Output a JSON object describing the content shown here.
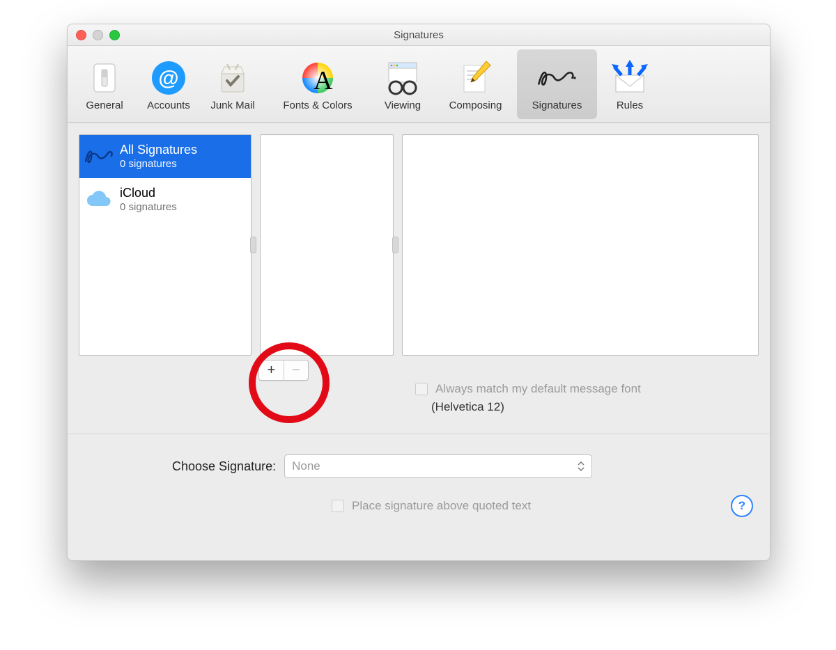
{
  "window": {
    "title": "Signatures"
  },
  "toolbar": [
    {
      "id": "general",
      "label": "General",
      "icon": "switch-icon",
      "selected": false
    },
    {
      "id": "accounts",
      "label": "Accounts",
      "icon": "at-icon",
      "selected": false
    },
    {
      "id": "junk",
      "label": "Junk Mail",
      "icon": "trash-icon",
      "selected": false
    },
    {
      "id": "fonts",
      "label": "Fonts & Colors",
      "icon": "colorwheel-icon",
      "selected": false
    },
    {
      "id": "viewing",
      "label": "Viewing",
      "icon": "glasses-icon",
      "selected": false
    },
    {
      "id": "composing",
      "label": "Composing",
      "icon": "compose-icon",
      "selected": false
    },
    {
      "id": "signatures",
      "label": "Signatures",
      "icon": "signature-icon",
      "selected": true
    },
    {
      "id": "rules",
      "label": "Rules",
      "icon": "rules-icon",
      "selected": false
    }
  ],
  "accounts_column": [
    {
      "id": "all",
      "title": "All Signatures",
      "sub": "0 signatures",
      "icon": "signature-icon",
      "selected": true
    },
    {
      "id": "icloud",
      "title": "iCloud",
      "sub": "0 signatures",
      "icon": "icloud-icon",
      "selected": false
    }
  ],
  "buttons": {
    "add": "+",
    "remove": "−"
  },
  "always_match": {
    "label": "Always match my default message font",
    "font": "(Helvetica 12)",
    "checked": false,
    "enabled": false
  },
  "choose_signature": {
    "label": "Choose Signature:",
    "value": "None",
    "enabled": false
  },
  "place_above": {
    "label": "Place signature above quoted text",
    "checked": false,
    "enabled": false
  },
  "help": "?"
}
